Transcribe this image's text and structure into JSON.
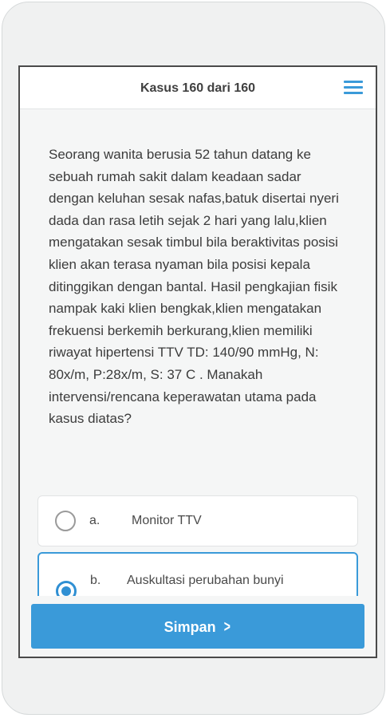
{
  "header": {
    "title": "Kasus 160 dari 160",
    "menu_icon": "hamburger-menu-icon"
  },
  "question": {
    "text": "Seorang wanita berusia 52 tahun datang ke sebuah rumah sakit dalam keadaan sadar dengan keluhan sesak nafas,batuk disertai nyeri dada dan rasa letih sejak 2 hari yang lalu,klien mengatakan sesak timbul bila beraktivitas posisi klien akan terasa nyaman bila posisi kepala ditinggikan dengan bantal. Hasil pengkajian fisik nampak kaki klien bengkak,klien mengatakan frekuensi berkemih berkurang,klien memiliki riwayat hipertensi TTV TD: 140/90 mmHg, N: 80x/m, P:28x/m, S: 37 C . Manakah intervensi/rencana keperawatan utama pada kasus diatas?"
  },
  "options": [
    {
      "letter": "a.",
      "text": "Monitor TTV",
      "selected": false
    },
    {
      "letter": "b.",
      "text": "Auskultasi perubahan bunyi",
      "selected": true
    }
  ],
  "footer": {
    "save_label": "Simpan",
    "save_icon": "chevron-right-icon",
    "accent_color": "#3a9ad9"
  }
}
